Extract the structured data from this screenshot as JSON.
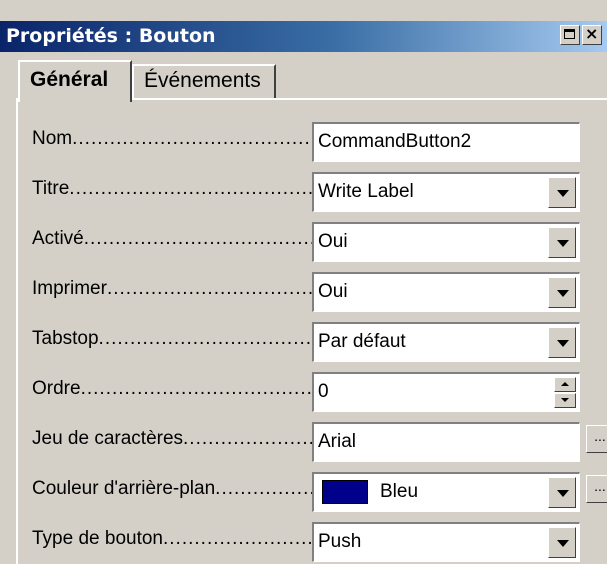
{
  "window": {
    "title": "Propriétés : Bouton",
    "close_label": "×"
  },
  "tabs": [
    {
      "label": "Général"
    },
    {
      "label": "Événements"
    }
  ],
  "properties": [
    {
      "label": "Nom",
      "value": "CommandButton2",
      "control": "text"
    },
    {
      "label": "Titre",
      "value": "Write Label",
      "control": "dropdown"
    },
    {
      "label": "Activé",
      "value": "Oui",
      "control": "dropdown"
    },
    {
      "label": "Imprimer",
      "value": "Oui",
      "control": "dropdown"
    },
    {
      "label": "Tabstop",
      "value": "Par défaut",
      "control": "dropdown"
    },
    {
      "label": "Ordre",
      "value": "0",
      "control": "spinner"
    },
    {
      "label": "Jeu de caractères",
      "value": "Arial",
      "control": "text-with-button"
    },
    {
      "label": "Couleur d'arrière-plan",
      "value": "Bleu",
      "control": "color-dropdown",
      "swatch_color": "#00008b"
    },
    {
      "label": "Type de bouton",
      "value": "Push",
      "control": "dropdown"
    }
  ],
  "ellipsis_label": "...",
  "colors": {
    "titlebar_start": "#0a246a",
    "titlebar_end": "#a6caf0",
    "background": "#d4d0c8"
  }
}
